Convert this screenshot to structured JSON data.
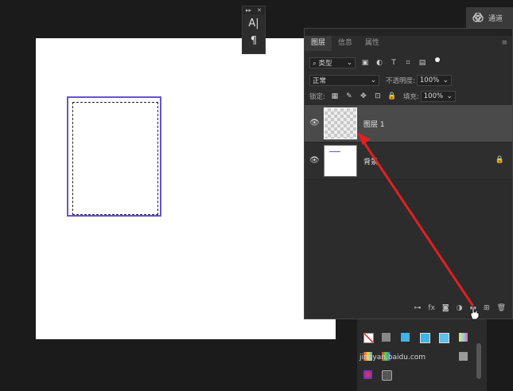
{
  "char_panel": {
    "top_left": "▸▸",
    "close": "✕",
    "char_icon": "A|",
    "para_icon": "¶"
  },
  "channels_tab": {
    "label": "通道"
  },
  "layers": {
    "tabs": [
      {
        "label": "图层"
      },
      {
        "label": "信息"
      },
      {
        "label": "属性"
      }
    ],
    "menu_icon": "≡",
    "filter": {
      "label": "⌕ 类型",
      "icons": [
        "▣",
        "◐",
        "T",
        "⌗",
        "▤"
      ]
    },
    "blend": {
      "mode": "正常",
      "opacity_label": "不透明度:",
      "opacity": "100%"
    },
    "lock": {
      "label": "锁定:",
      "icons": [
        "▦",
        "✎",
        "✥",
        "⊡",
        "🔒"
      ],
      "fill_label": "填充:",
      "fill": "100%"
    },
    "items": [
      {
        "name": "图层 1",
        "visible": true,
        "selected": true
      },
      {
        "name": "背景",
        "visible": true,
        "locked": true
      }
    ],
    "bottom_icons": [
      "⊶",
      "fx",
      "◙",
      "◑",
      "▬",
      "⊞",
      "🗑"
    ]
  },
  "colors": {
    "accent_shape": "#6655cc",
    "arrow": "#e02020"
  },
  "watermark": "jingyan.baidu.com"
}
